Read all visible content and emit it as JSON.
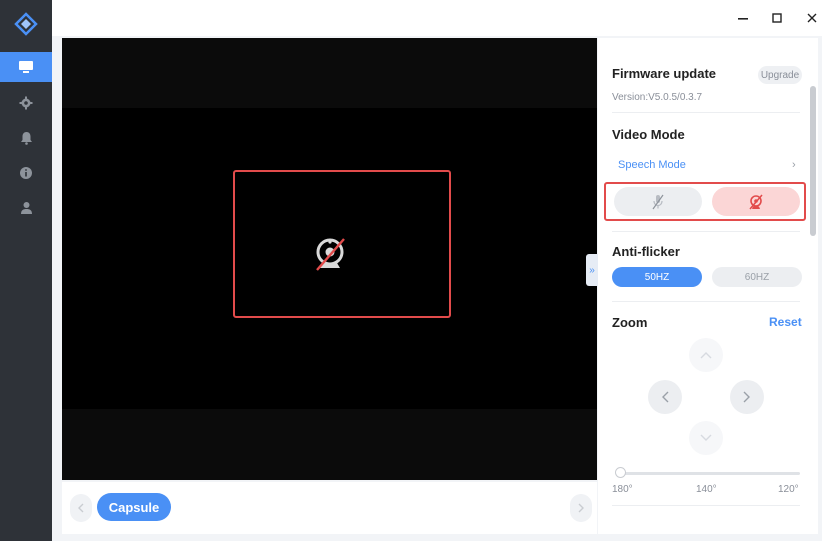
{
  "sidebar": {
    "logo_icon": "app-logo-icon",
    "items": [
      {
        "icon": "monitor-icon",
        "active": true
      },
      {
        "icon": "gear-icon",
        "active": false
      },
      {
        "icon": "bell-icon",
        "active": false
      },
      {
        "icon": "info-icon",
        "active": false
      },
      {
        "icon": "user-icon",
        "active": false
      }
    ]
  },
  "window_controls": {
    "minimize": "−",
    "maximize": "☐",
    "close": "✕"
  },
  "video": {
    "state_icon": "camera-off-icon"
  },
  "bottom": {
    "capsule_label": "Capsule"
  },
  "panel": {
    "firmware": {
      "title": "Firmware update",
      "badge": "Upgrade",
      "version": "Version:V5.0.5/0.3.7"
    },
    "video_mode": {
      "title": "Video Mode",
      "selected": "Speech Mode",
      "buttons": [
        "mic-off-icon",
        "camera-off-icon"
      ]
    },
    "anti_flicker": {
      "title": "Anti-flicker",
      "options": [
        "50HZ",
        "60HZ"
      ],
      "selected": "50HZ"
    },
    "zoom": {
      "title": "Zoom",
      "reset": "Reset",
      "ticks": [
        "180°",
        "140°",
        "120°"
      ],
      "slider_value_fraction": 0.0
    }
  },
  "colors": {
    "accent": "#4a90f5",
    "highlight": "#e24b4b",
    "sidebar_bg": "#2e3238"
  }
}
